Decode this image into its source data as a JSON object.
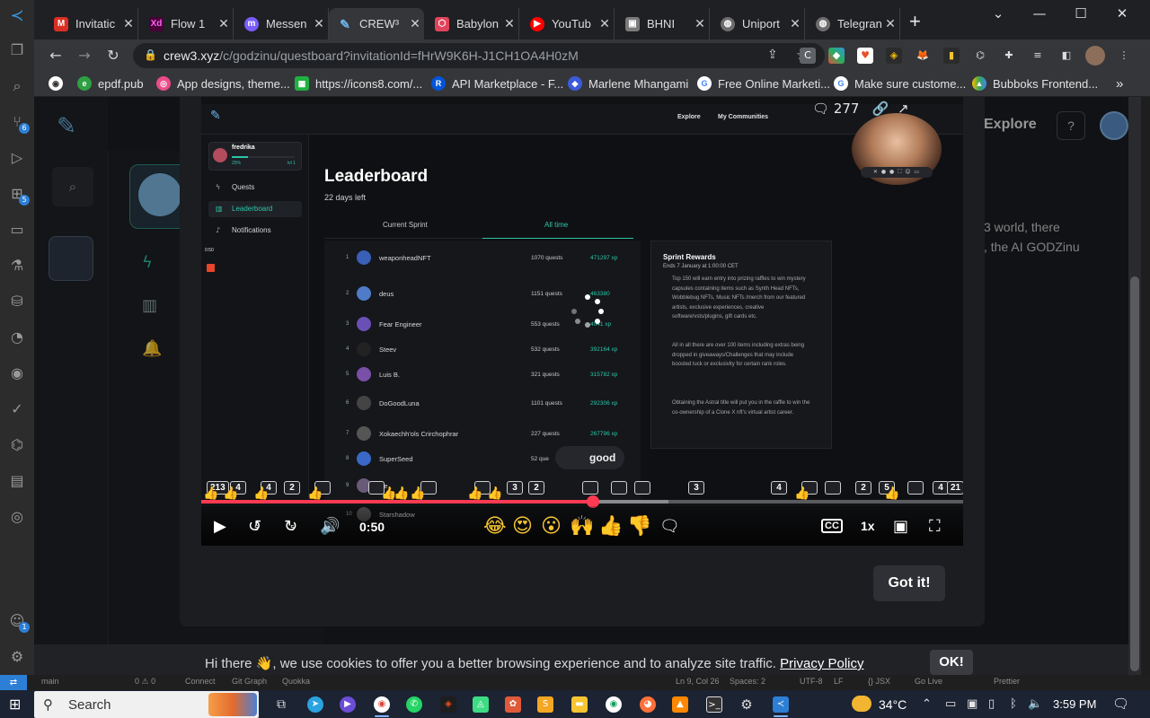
{
  "browser": {
    "tabs": [
      {
        "title": "Invitatic",
        "icon": "gmail-icon",
        "color": "#d93025"
      },
      {
        "title": "Flow 1",
        "icon": "adobe-xd-icon",
        "color": "#470137"
      },
      {
        "title": "Messen",
        "icon": "messenger-icon",
        "color": "#7b5cff"
      },
      {
        "title": "CREW³",
        "icon": "crew3-icon",
        "color": "#6bb3e8",
        "active": true
      },
      {
        "title": "Babylon",
        "icon": "babylon-icon",
        "color": "#e0445a"
      },
      {
        "title": "YouTub",
        "icon": "youtube-icon",
        "color": "#ff0000"
      },
      {
        "title": "BHNI",
        "icon": "bhni-icon",
        "color": "#7a7a7a"
      },
      {
        "title": "Uniport",
        "icon": "globe-icon",
        "color": "#6d6d6d"
      },
      {
        "title": "Telegran",
        "icon": "globe-icon",
        "color": "#6d6d6d"
      }
    ],
    "new_tab": "+",
    "url_host": "crew3.xyz",
    "url_path": "/c/godzinu/questboard?invitationId=fHrW9K6H-J1CH1OA4H0zM",
    "bookmarks": [
      {
        "label": "",
        "icon": "chrome-icon"
      },
      {
        "label": "epdf.pub",
        "icon": "epdf-icon"
      },
      {
        "label": "App designs, theme...",
        "icon": "dribbble-icon"
      },
      {
        "label": "https://icons8.com/...",
        "icon": "icons8-icon"
      },
      {
        "label": "API Marketplace - F...",
        "icon": "rapidapi-icon"
      },
      {
        "label": "Marlene Mhangami",
        "icon": "diamond-icon"
      },
      {
        "label": "Free Online Marketi...",
        "icon": "google-icon"
      },
      {
        "label": "Make sure custome...",
        "icon": "google-icon"
      },
      {
        "label": "Bubboks Frontend...",
        "icon": "drive-icon"
      }
    ],
    "bookmarks_more": "»"
  },
  "background_page": {
    "explore_label": "Explore",
    "help_label": "?",
    "text_line1": "3 world, there",
    "text_line2": ", the AI GODZinu"
  },
  "video": {
    "top_nav": [
      "Explore",
      "My Communities"
    ],
    "top_comment_count": "277",
    "user": {
      "name": "fredrika",
      "percent": "25%",
      "level": "lvl 1"
    },
    "side_items": [
      "Quests",
      "Leaderboard",
      "Notifications"
    ],
    "side_time": "0:50",
    "title": "Leaderboard",
    "days_left": "22 days left",
    "tabs": [
      "Current Sprint",
      "All time"
    ],
    "rows": [
      {
        "rank": "1",
        "name": "weaponheadNFT",
        "quests": "1070 quests",
        "xp": "471297 xp",
        "color": "#3a5fb6"
      },
      {
        "rank": "2",
        "name": "deus",
        "quests": "1151 quests",
        "xp": "463380",
        "color": "#4f7cc9"
      },
      {
        "rank": "3",
        "name": "Fear Engineer",
        "quests": "553 quests",
        "xp": "4041 xp",
        "color": "#6a4fb5"
      },
      {
        "rank": "4",
        "name": "Steev",
        "quests": "532 quests",
        "xp": "392164 xp",
        "color": "#222222"
      },
      {
        "rank": "5",
        "name": "Luis B.",
        "quests": "321 quests",
        "xp": "315782 xp",
        "color": "#7a4fa8"
      },
      {
        "rank": "6",
        "name": "DoGoodLuna",
        "quests": "1101 quests",
        "xp": "292306 xp",
        "color": "#444444"
      },
      {
        "rank": "7",
        "name": "Xokaechh'ols Crirchophrar",
        "quests": "227 quests",
        "xp": "267796 xp",
        "color": "#555555"
      },
      {
        "rank": "8",
        "name": "SuperSeed",
        "quests": "52 que",
        "xp": "",
        "color": "#3a68c6"
      },
      {
        "rank": "9",
        "name": "Ne",
        "quests": "uests",
        "xp": "",
        "color": "#6a5a7a"
      },
      {
        "rank": "10",
        "name": "Starshadow",
        "quests": "",
        "xp": "",
        "color": "#555555"
      }
    ],
    "rewards": {
      "title": "Sprint Rewards",
      "subtitle": "Ends 7 January at 1:00:00 CET",
      "p1": "Top 150 will earn entry into prizing raffles to win mystery capsules containing items such as Synth Head NFTs, Wobblebug NFTs, Music NFTs /merch from our featured artists, exclusive experiences, creative software/vsts/plugins, gift cards etc.",
      "p2": "All in all there are over 100 items including extras being dropped in giveaways/Challenges that may include boosted luck or exclusivity for certain rank roles.",
      "p3": "Obtaining the Astral title will put you in the raffle to win the co-ownership of a Clone X nft's virtual artist career."
    },
    "comment_chip": {
      "initial": "O",
      "text": "good"
    },
    "reaction_bubbles": [
      "213",
      "4",
      "4",
      "2",
      "",
      "",
      "",
      "",
      "3",
      "2",
      "",
      "",
      "",
      "3",
      "4",
      "",
      "",
      "2",
      "5",
      "",
      "4",
      "21"
    ],
    "progress": 0.514,
    "current_time": "0:50",
    "speed": "1x",
    "cc_label": "CC",
    "skip_back": "5",
    "skip_fwd": "5"
  },
  "modal": {
    "got_it": "Got it!"
  },
  "cookie": {
    "text": "Hi there 👋, we use cookies to offer you a better browsing experience and to analyze site traffic.",
    "link": "Privacy Policy",
    "ok": "OK!"
  },
  "vs_status": [
    "main",
    "0 ⚠ 0",
    "Connect",
    "Git Graph",
    "Quokka",
    "Ln 9, Col 26",
    "Spaces: 2",
    "UTF-8",
    "LF",
    "{} JSX",
    "Go Live",
    "Prettier"
  ],
  "vs_badges": {
    "git": "6",
    "extensions": "5",
    "account": "1"
  },
  "taskbar": {
    "search_label": "Search",
    "temperature": "34°C",
    "time": "3:59 PM"
  }
}
